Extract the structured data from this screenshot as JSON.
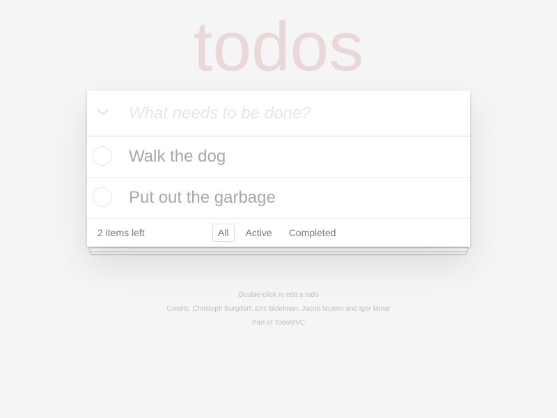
{
  "app": {
    "title": "todos"
  },
  "new_todo": {
    "placeholder": "What needs to be done?",
    "value": ""
  },
  "todos": [
    {
      "label": "Walk the dog",
      "completed": false
    },
    {
      "label": "Put out the garbage",
      "completed": false
    }
  ],
  "footer": {
    "count_text": "2 items left",
    "filters": [
      {
        "label": "All",
        "selected": true
      },
      {
        "label": "Active",
        "selected": false
      },
      {
        "label": "Completed",
        "selected": false
      }
    ]
  },
  "info": {
    "hint": "Double-click to edit a todo",
    "credits": "Credits: Christoph Burgdorf, Eric Bidelman, Jacob Mumm and Igor Minar",
    "part_of": "Part of TodoMVC"
  },
  "colors": {
    "background": "#f5f5f5",
    "title": "#e8d7d7",
    "selected_filter_border": "#efd5d5"
  },
  "icons": {
    "toggle_all": "chevron-down-icon"
  }
}
